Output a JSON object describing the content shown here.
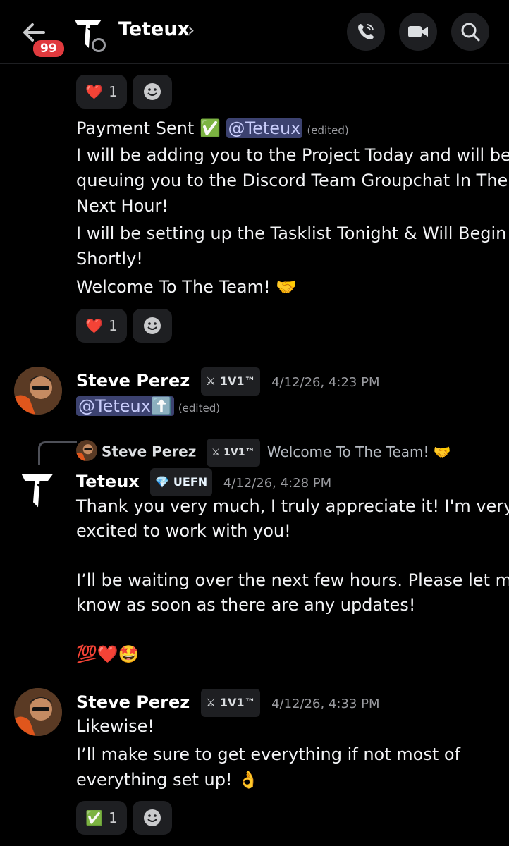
{
  "header": {
    "unread_count": "99",
    "title": "Teteux",
    "chevron": "›",
    "icons": [
      "back-arrow-icon",
      "phone-icon",
      "video-camera-icon",
      "search-icon"
    ]
  },
  "messages": {
    "top_reaction": {
      "emoji": "❤️",
      "count": "1"
    },
    "teteux_block": {
      "line1_prefix": "Payment Sent",
      "line1_check": "✅",
      "mention": "@Teteux",
      "edited": "(edited)",
      "line2": "I will be adding you to the Project Today and will be",
      "line3": "queuing you to the Discord Team Groupchat In The",
      "line4": "Next Hour!",
      "line5": "I will be setting up the Tasklist Tonight & Will Begin",
      "line6": "Shortly!",
      "line7": "Welcome To The Team! 🤝",
      "reaction": {
        "emoji": "❤️",
        "count": "1"
      }
    },
    "steve_1": {
      "name": "Steve Perez",
      "tag": "⚔ 1V1™",
      "timestamp": "4/12/26, 4:23 PM",
      "mention": "@Teteux⬆️",
      "edited": "(edited)"
    },
    "teteux_reply": {
      "reply_name": "Steve Perez",
      "reply_tag": "⚔ 1V1™",
      "reply_text": "Welcome To The Team! 🤝",
      "name": "Teteux",
      "tag": "💎 UEFN",
      "timestamp": "4/12/26, 4:28 PM",
      "line1": "Thank you very much, I truly appreciate it! I'm very",
      "line2": "excited to work with you!",
      "line3": "I’ll be waiting over the next few hours. Please let me",
      "line4": "know as soon as there are any updates!",
      "line5": "💯❤️🤩"
    },
    "steve_2": {
      "name": "Steve Perez",
      "tag": "⚔ 1V1™",
      "timestamp": "4/12/26, 4:33 PM",
      "line1": "Likewise!",
      "line2": "I’ll make sure to get everything if not most of",
      "line3": "everything set up! 👌",
      "reaction": {
        "emoji": "✅",
        "count": "1"
      }
    }
  },
  "colors": {
    "background": "#000000",
    "mention_bg": "#3c4270",
    "mention_fg": "#c9cdfb",
    "badge": "#e03a3e",
    "pill": "#1e1f22",
    "muted": "#9a9ba0"
  }
}
